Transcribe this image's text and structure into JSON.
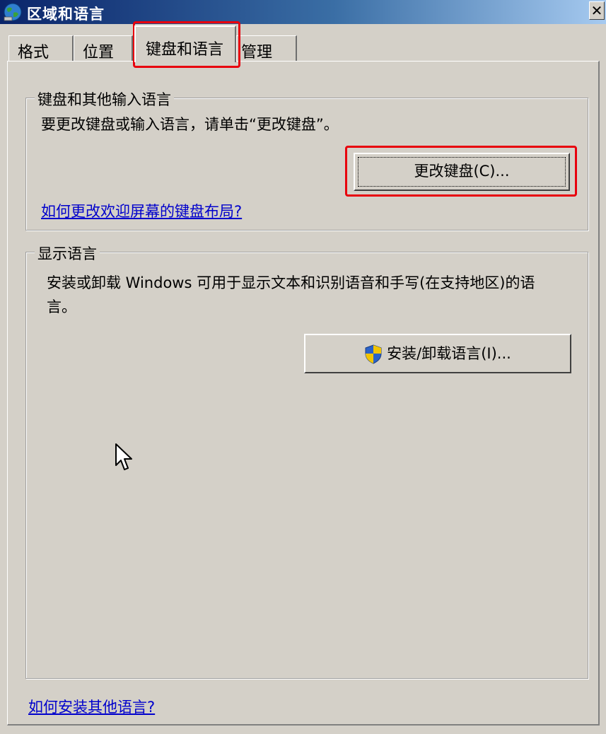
{
  "window": {
    "title": "区域和语言",
    "close_glyph": "✕"
  },
  "tabs": [
    {
      "label": "格式"
    },
    {
      "label": "位置"
    },
    {
      "label": "键盘和语言",
      "active": true
    },
    {
      "label": "管理"
    }
  ],
  "keyboard_group": {
    "legend": "键盘和其他输入语言",
    "description": "要更改键盘或输入语言，请单击“更改键盘”。",
    "change_button": "更改键盘(C)...",
    "welcome_link": "如何更改欢迎屏幕的键盘布局?"
  },
  "display_group": {
    "legend": "显示语言",
    "description_line1": "安装或卸载 Windows 可用于显示文本和识别语音和手写(在支持地区)的语",
    "description_line2": "言。",
    "install_button": "安装/卸载语言(I)..."
  },
  "footer_link": "如何安装其他语言?",
  "icons": {
    "title": "globe-icon",
    "shield": "uac-shield-icon",
    "cursor": "mouse-cursor-icon"
  },
  "colors": {
    "highlight": "#e8000d",
    "link": "#0000cc",
    "dialog_bg": "#d4d0c8"
  }
}
